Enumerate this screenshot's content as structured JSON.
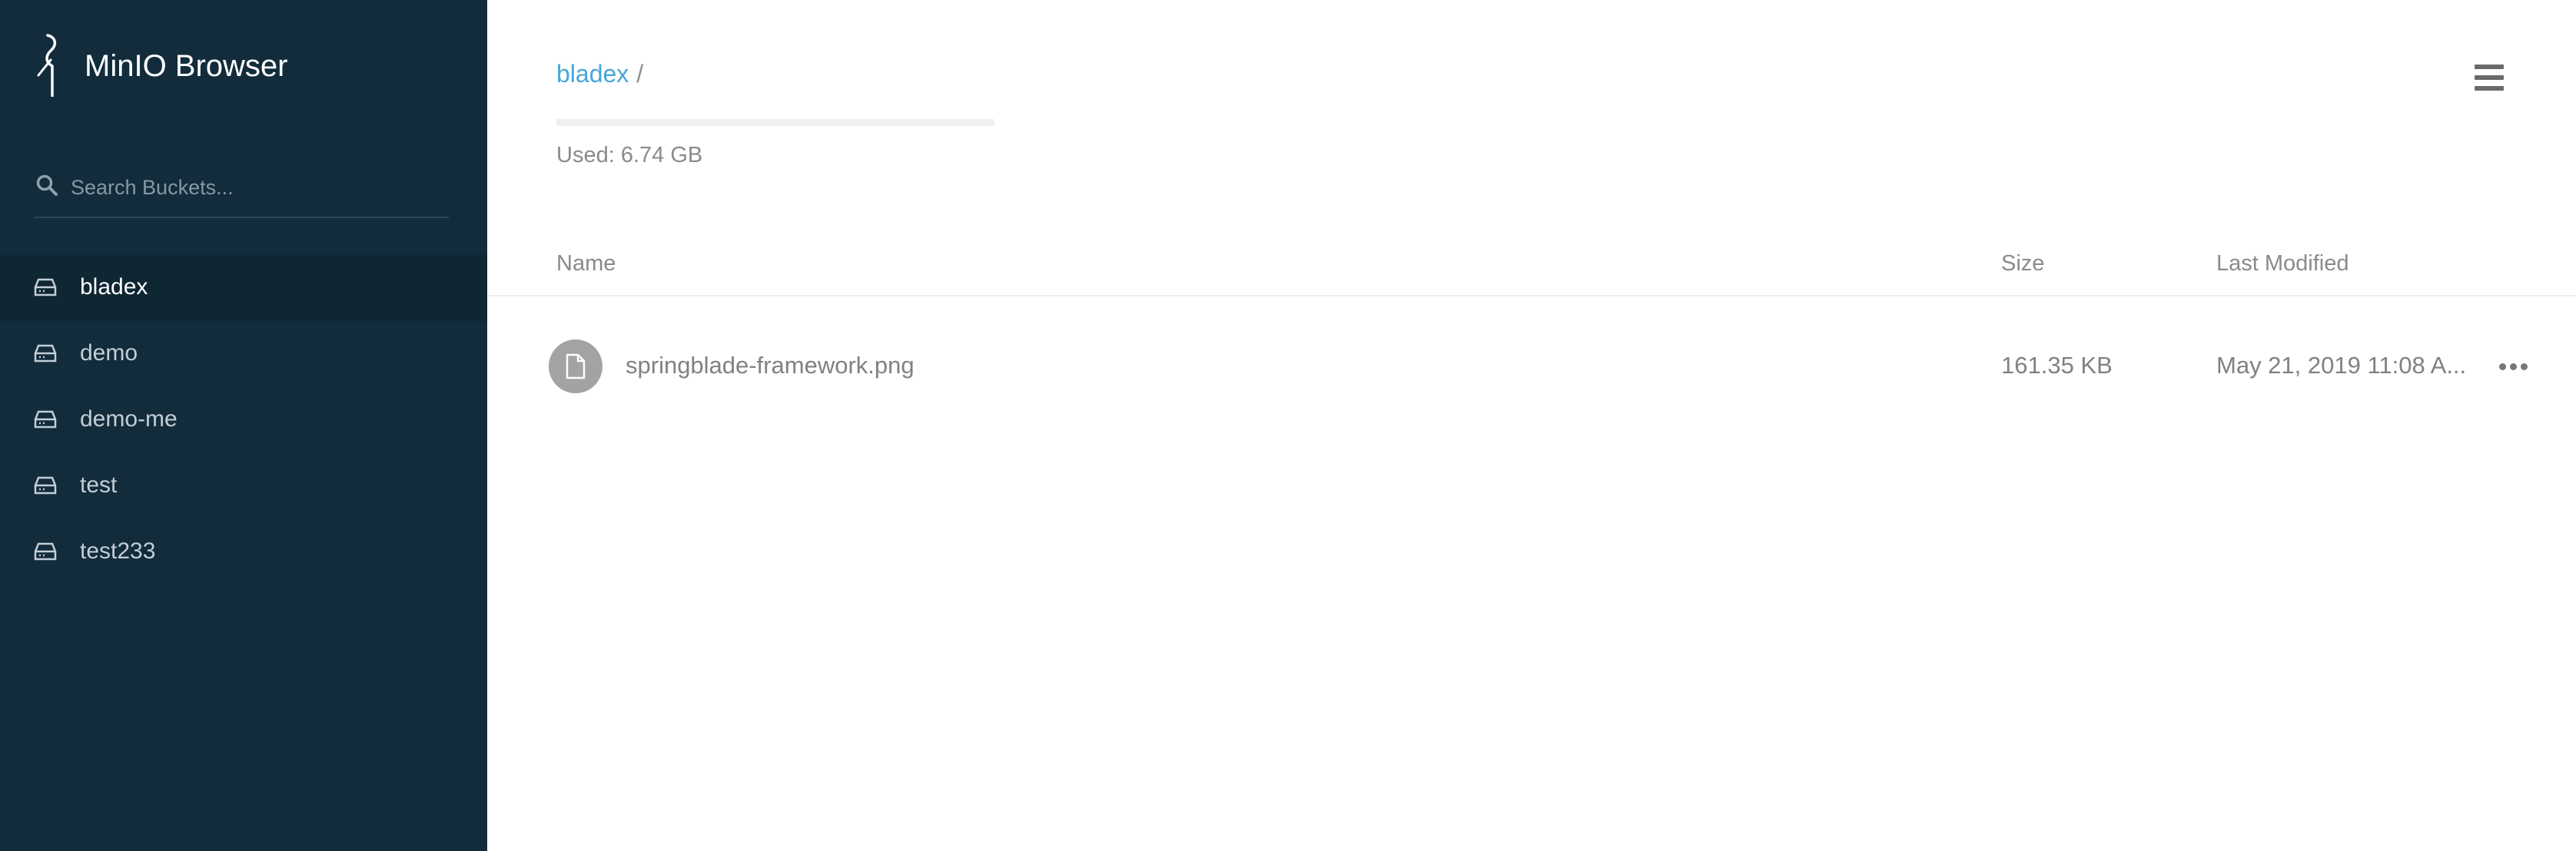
{
  "app": {
    "title": "MinIO Browser",
    "logo_icon": "minio-bird-icon"
  },
  "sidebar": {
    "search": {
      "placeholder": "Search Buckets...",
      "value": "",
      "icon": "search-icon"
    },
    "buckets": [
      {
        "label": "bladex",
        "active": true,
        "icon": "bucket-drive-icon"
      },
      {
        "label": "demo",
        "active": false,
        "icon": "bucket-drive-icon"
      },
      {
        "label": "demo-me",
        "active": false,
        "icon": "bucket-drive-icon"
      },
      {
        "label": "test",
        "active": false,
        "icon": "bucket-drive-icon"
      },
      {
        "label": "test233",
        "active": false,
        "icon": "bucket-drive-icon"
      }
    ]
  },
  "main": {
    "breadcrumb": {
      "bucket": "bladex",
      "separator": "/"
    },
    "usage": {
      "text": "Used: 6.74 GB",
      "fill_fraction": 0
    },
    "menu_icon": "hamburger-menu-icon",
    "table": {
      "headers": {
        "name": "Name",
        "size": "Size",
        "modified": "Last Modified"
      },
      "rows": [
        {
          "name": "springblade-framework.png",
          "size": "161.35 KB",
          "modified": "May 21, 2019 11:08 A...",
          "icon": "file-icon",
          "actions_icon": "more-actions-icon"
        }
      ]
    }
  },
  "colors": {
    "sidebar_bg": "#122c3c",
    "link": "#46a6d8",
    "text_muted": "#8a8a8a"
  }
}
